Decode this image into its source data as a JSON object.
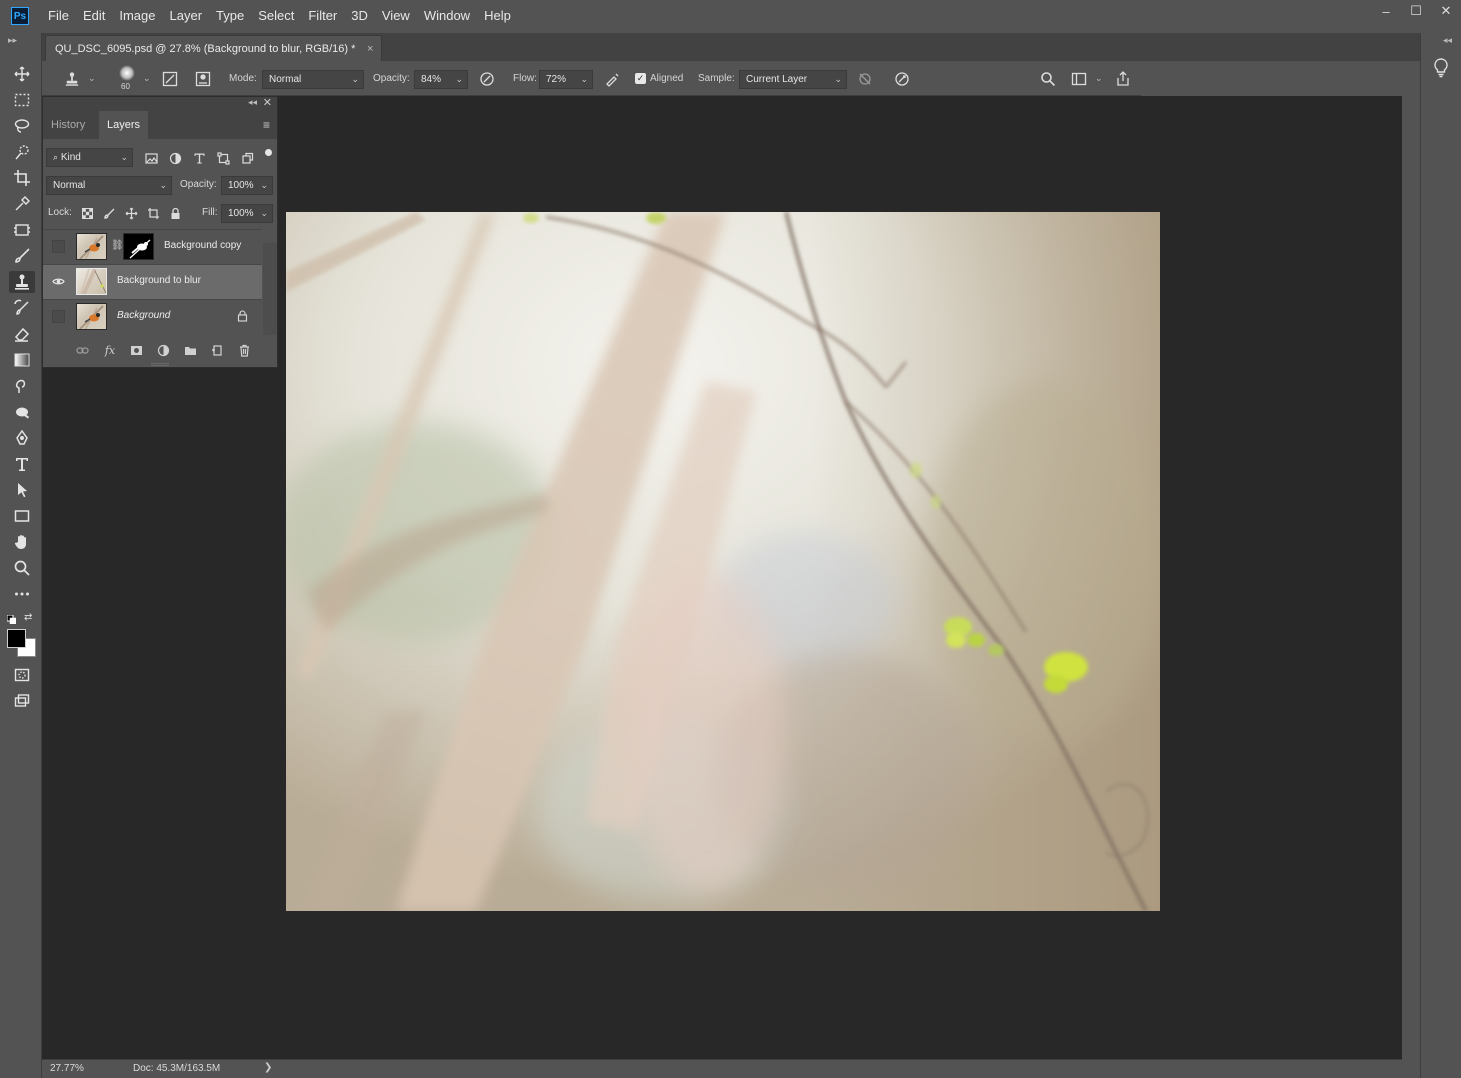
{
  "app": {
    "logo_text": "Ps",
    "menu": [
      "File",
      "Edit",
      "Image",
      "Layer",
      "Type",
      "Select",
      "Filter",
      "3D",
      "View",
      "Window",
      "Help"
    ],
    "window_controls": [
      "–",
      "☐",
      "✕"
    ]
  },
  "document_tab": {
    "title": "QU_DSC_6095.psd @ 27.8% (Background to blur, RGB/16) *",
    "close": "×"
  },
  "options_bar": {
    "brush_size": "60",
    "mode_label": "Mode:",
    "mode_value": "Normal",
    "opacity_label": "Opacity:",
    "opacity_value": "84%",
    "flow_label": "Flow:",
    "flow_value": "72%",
    "aligned_checked": true,
    "aligned_label": "Aligned",
    "sample_label": "Sample:",
    "sample_value": "Current Layer"
  },
  "layers_panel": {
    "tabs": [
      "History",
      "Layers"
    ],
    "active_tab": "Layers",
    "filter_kind": "Kind",
    "blend_mode": "Normal",
    "opacity_label": "Opacity:",
    "opacity_value": "100%",
    "lock_label": "Lock:",
    "fill_label": "Fill:",
    "fill_value": "100%",
    "layers": [
      {
        "name": "Background copy",
        "visible": false,
        "selected": false,
        "has_mask": true,
        "locked": false,
        "italic": false
      },
      {
        "name": "Background to blur",
        "visible": true,
        "selected": true,
        "has_mask": false,
        "locked": false,
        "italic": false
      },
      {
        "name": "Background",
        "visible": false,
        "selected": false,
        "has_mask": false,
        "locked": true,
        "italic": true
      }
    ]
  },
  "status_bar": {
    "zoom": "27.77%",
    "doc_size": "Doc: 45.3M/163.5M",
    "arrow": "❯"
  },
  "colors": {
    "ui_bg": "#535353",
    "canvas_bg": "#282828",
    "accent": "#31a8ff",
    "leaf_green": "#c8e23a"
  },
  "icons": {
    "toolbar": [
      "move-icon",
      "marquee-icon",
      "lasso-icon",
      "quick-select-icon",
      "crop-icon",
      "eyedropper-icon",
      "frame-icon",
      "brush-icon",
      "clone-stamp-icon",
      "history-brush-icon",
      "eraser-icon",
      "gradient-icon",
      "smudge-icon",
      "dodge-icon",
      "pen-icon",
      "type-icon",
      "path-select-icon",
      "rectangle-icon",
      "hand-icon",
      "zoom-icon",
      "more-icon",
      "quick-mask-icon",
      "screen-mode-icon"
    ]
  }
}
